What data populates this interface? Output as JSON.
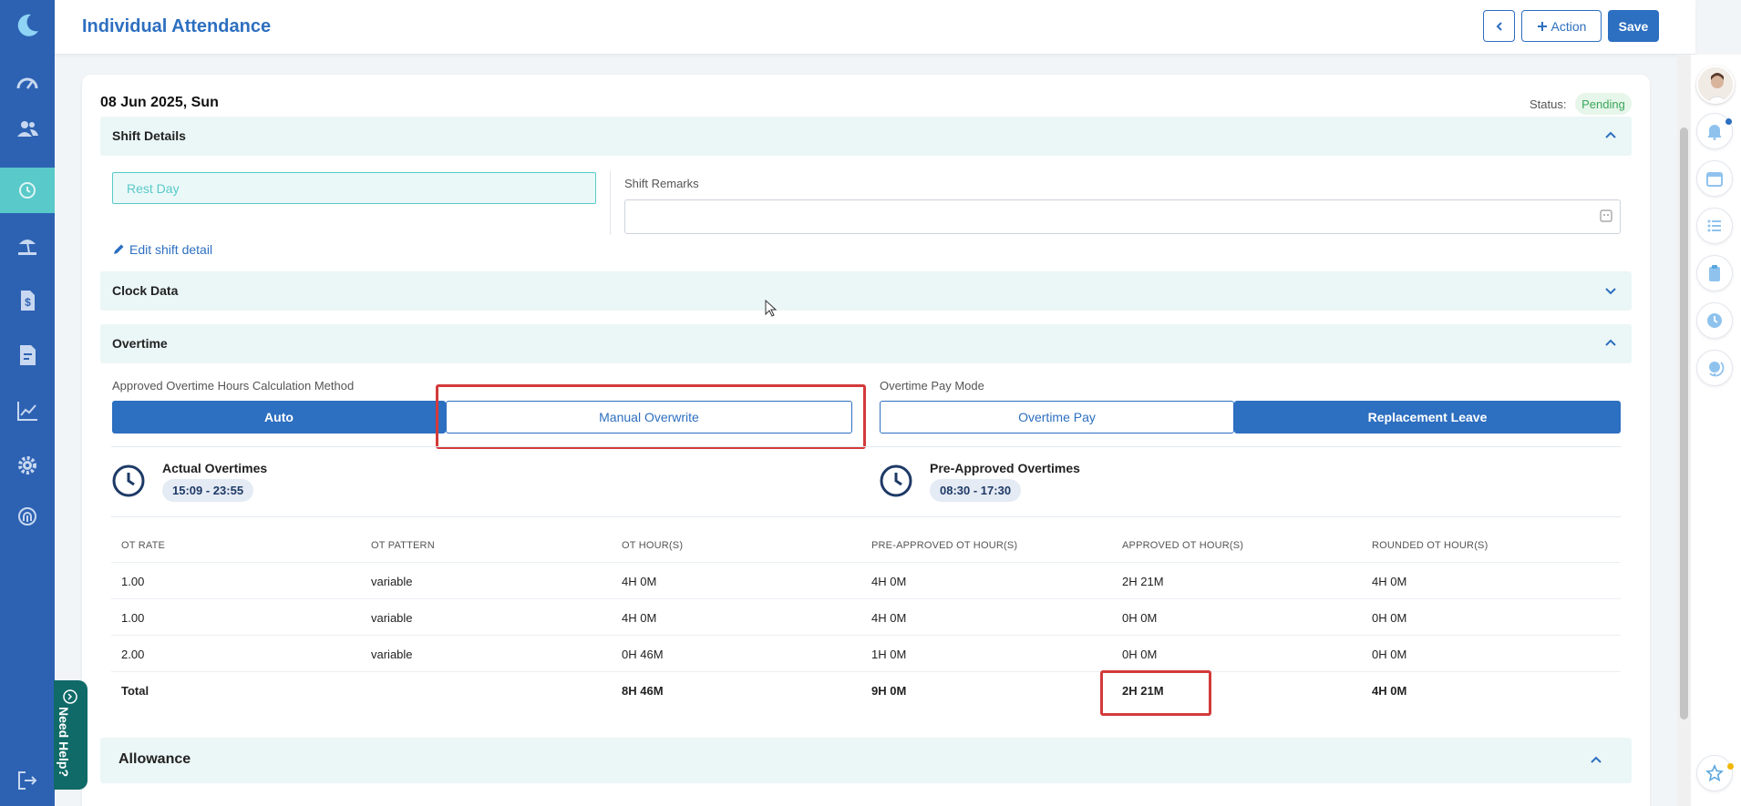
{
  "colors": {
    "primary": "#2d6fc0",
    "sidebar": "#2d62b3",
    "teal": "#59c9c9",
    "highlight_red": "#d33a3a",
    "status_green": "#3aa65a"
  },
  "sidebar": {
    "items": [
      {
        "icon": "dashboard-icon"
      },
      {
        "icon": "people-icon"
      },
      {
        "icon": "clock-history-icon",
        "active": true
      },
      {
        "icon": "leave-beach-icon"
      },
      {
        "icon": "payroll-dollar-icon"
      },
      {
        "icon": "document-icon"
      },
      {
        "icon": "report-chart-icon"
      },
      {
        "icon": "settings-gear-icon"
      },
      {
        "icon": "fingerprint-icon"
      },
      {
        "icon": "logout-icon"
      }
    ]
  },
  "header": {
    "title": "Individual Attendance",
    "action_label": "Action",
    "save_label": "Save"
  },
  "record": {
    "date": "08 Jun 2025, Sun",
    "status_label": "Status:",
    "status": "Pending"
  },
  "shift_details": {
    "title": "Shift Details",
    "shift_value": "Rest Day",
    "remarks_label": "Shift Remarks",
    "remarks_value": "",
    "edit_link": "Edit shift detail"
  },
  "clock_data": {
    "title": "Clock Data"
  },
  "overtime": {
    "title": "Overtime",
    "calc_method_label": "Approved Overtime Hours Calculation Method",
    "calc_options": [
      "Auto",
      "Manual Overwrite"
    ],
    "calc_selected": "Auto",
    "pay_mode_label": "Overtime Pay Mode",
    "pay_options": [
      "Overtime Pay",
      "Replacement Leave"
    ],
    "pay_selected": "Replacement Leave",
    "actual_title": "Actual Overtimes",
    "actual_range": "15:09 - 23:55",
    "preapproved_title": "Pre-Approved Overtimes",
    "preapproved_range": "08:30 - 17:30",
    "table": {
      "headers": [
        "OT RATE",
        "OT PATTERN",
        "OT HOUR(S)",
        "PRE-APPROVED OT HOUR(S)",
        "APPROVED OT HOUR(S)",
        "ROUNDED OT HOUR(S)"
      ],
      "rows": [
        [
          "1.00",
          "variable",
          "4H 0M",
          "4H 0M",
          "2H 21M",
          "4H 0M"
        ],
        [
          "1.00",
          "variable",
          "4H 0M",
          "4H 0M",
          "0H 0M",
          "0H 0M"
        ],
        [
          "2.00",
          "variable",
          "0H 46M",
          "1H 0M",
          "0H 0M",
          "0H 0M"
        ]
      ],
      "total": [
        "Total",
        "",
        "8H 46M",
        "9H 0M",
        "2H 21M",
        "4H 0M"
      ]
    }
  },
  "allowance": {
    "title": "Allowance"
  },
  "help": {
    "label": "Need Help?"
  }
}
